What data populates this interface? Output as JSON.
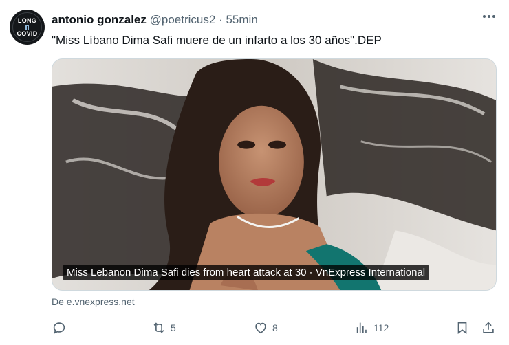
{
  "author": {
    "name": "antonio gonzalez",
    "handle": "@poetricus2",
    "separator": "·",
    "time": "55min",
    "avatar_text": [
      "LONG",
      "COVID"
    ]
  },
  "tweet": {
    "text": "\"Miss Líbano Dima Safi muere de un infarto a los 30 años\".DEP"
  },
  "card": {
    "caption": "Miss Lebanon Dima Safi dies from heart attack at 30 - VnExpress International",
    "source": "De e.vnexpress.net"
  },
  "actions": {
    "reply_count": "",
    "retweet_count": "5",
    "like_count": "8",
    "views_count": "112"
  },
  "icons": {
    "more": "more-icon",
    "reply": "reply-icon",
    "retweet": "retweet-icon",
    "like": "heart-icon",
    "views": "views-icon",
    "bookmark": "bookmark-icon",
    "share": "share-icon"
  }
}
